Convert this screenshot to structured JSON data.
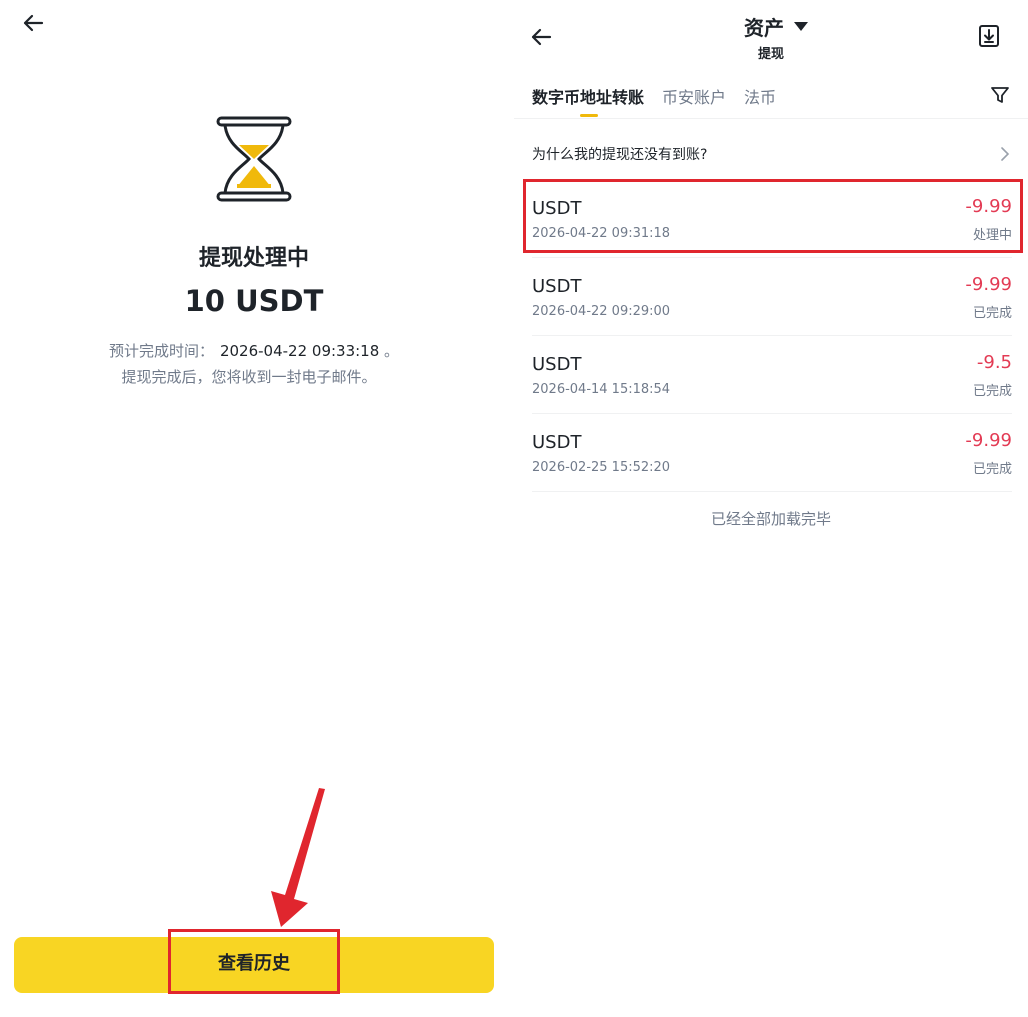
{
  "left": {
    "status_title": "提现处理中",
    "amount": "10 USDT",
    "eta_label": "预计完成时间：",
    "eta_time": "2026-04-22 09:33:18",
    "eta_suffix": "。",
    "email_note": "提现完成后，您将收到一封电子邮件。",
    "history_button": "查看历史",
    "accent_color": "#f8d523",
    "highlight_color": "#e0262e"
  },
  "right": {
    "title": "资产",
    "subtitle": "提现",
    "tabs": [
      {
        "label": "数字币地址转账",
        "active": true
      },
      {
        "label": "币安账户",
        "active": false
      },
      {
        "label": "法币",
        "active": false
      }
    ],
    "why_text": "为什么我的提现还没有到账?",
    "transactions": [
      {
        "coin": "USDT",
        "time": "2026-04-22 09:31:18",
        "amount": "-9.99",
        "status": "处理中"
      },
      {
        "coin": "USDT",
        "time": "2026-04-22 09:29:00",
        "amount": "-9.99",
        "status": "已完成"
      },
      {
        "coin": "USDT",
        "time": "2026-04-14 15:18:54",
        "amount": "-9.5",
        "status": "已完成"
      },
      {
        "coin": "USDT",
        "time": "2026-02-25 15:52:20",
        "amount": "-9.99",
        "status": "已完成"
      }
    ],
    "all_loaded": "已经全部加载完毕",
    "negative_color": "#e33b54"
  },
  "icons": [
    "back-arrow-icon",
    "hourglass-icon",
    "caret-down-icon",
    "export-icon",
    "filter-icon",
    "chevron-right-icon"
  ]
}
